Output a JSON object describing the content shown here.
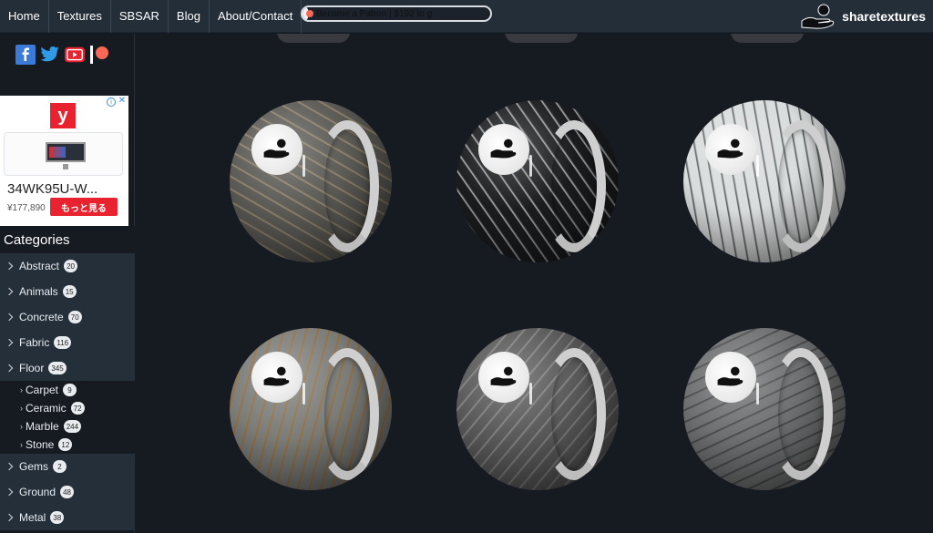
{
  "nav": {
    "items": [
      "Home",
      "Textures",
      "SBSAR",
      "Blog",
      "About/Contact"
    ],
    "patron_label": "Become a Patron | $192 to g",
    "patron_progress_percent": 3,
    "brand": "sharetextures"
  },
  "social": [
    "facebook-icon",
    "twitter-icon",
    "youtube-icon",
    "patreon-icon"
  ],
  "ad": {
    "logo": "y",
    "title": "34WK95U-W...",
    "price": "¥177,890",
    "button": "もっと見る",
    "close": "✕",
    "info": "i"
  },
  "sidebar": {
    "heading": "Categories",
    "categories": [
      {
        "label": "Abstract",
        "count": "20"
      },
      {
        "label": "Animals",
        "count": "15"
      },
      {
        "label": "Concrete",
        "count": "70"
      },
      {
        "label": "Fabric",
        "count": "116"
      },
      {
        "label": "Floor",
        "count": "345"
      }
    ],
    "subcategories": [
      {
        "label": "Carpet",
        "count": "9"
      },
      {
        "label": "Ceramic",
        "count": "72"
      },
      {
        "label": "Marble",
        "count": "244"
      },
      {
        "label": "Stone",
        "count": "12"
      }
    ],
    "categories_after": [
      {
        "label": "Gems",
        "count": "2"
      },
      {
        "label": "Ground",
        "count": "48"
      },
      {
        "label": "Metal",
        "count": "38"
      }
    ]
  },
  "grid": {
    "spheres": [
      {
        "name": "marble-texture-1",
        "base": "#5b5a55",
        "veins": "#9a8a70"
      },
      {
        "name": "marble-texture-2",
        "base": "#1b1c1e",
        "veins": "#b8bcc0"
      },
      {
        "name": "marble-texture-3",
        "base": "#d9dcdc",
        "veins": "#4a4d50"
      },
      {
        "name": "marble-texture-4",
        "base": "#7b7c78",
        "veins": "#9a6a30"
      },
      {
        "name": "marble-texture-5",
        "base": "#59595a",
        "veins": "#8a8a88"
      },
      {
        "name": "marble-texture-6",
        "base": "#6e6f70",
        "veins": "#3e3f40"
      }
    ]
  },
  "colors": {
    "nav_bg": "#242e39",
    "page_bg": "#161a21",
    "category_bg": "#252f3a",
    "accent_red": "#e8222e"
  }
}
